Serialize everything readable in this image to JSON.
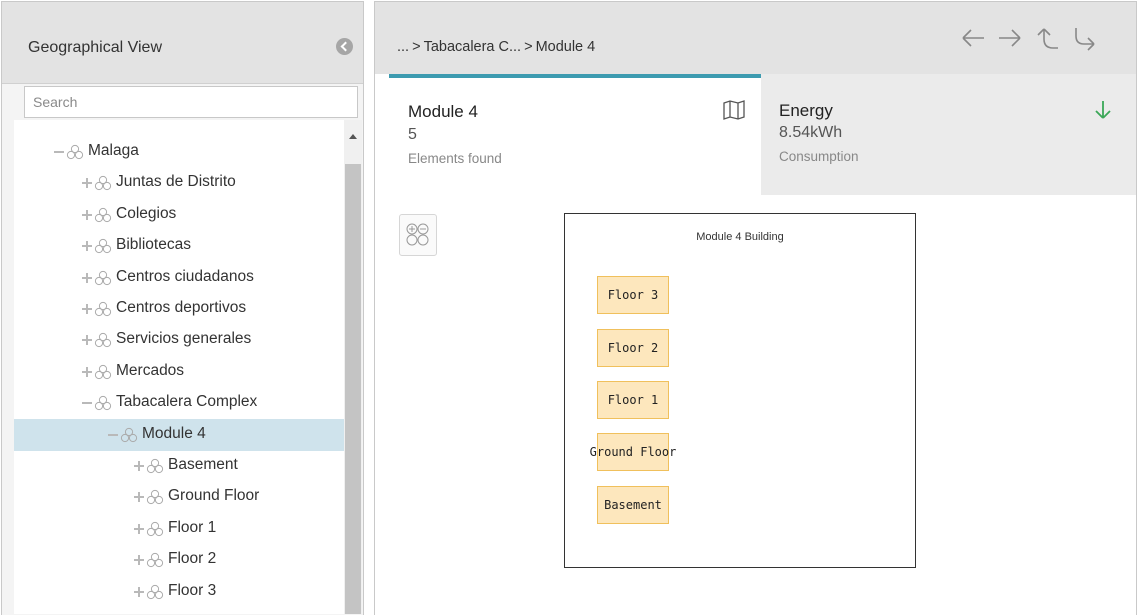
{
  "left_panel": {
    "title": "Geographical View",
    "search_placeholder": "Search",
    "partial_row": "...",
    "tree": [
      {
        "label": "Malaga",
        "level": 1,
        "toggle": "minus"
      },
      {
        "label": "Juntas de Distrito",
        "level": 2,
        "toggle": "plus"
      },
      {
        "label": "Colegios",
        "level": 2,
        "toggle": "plus"
      },
      {
        "label": "Bibliotecas",
        "level": 2,
        "toggle": "plus"
      },
      {
        "label": "Centros ciudadanos",
        "level": 2,
        "toggle": "plus"
      },
      {
        "label": "Centros deportivos",
        "level": 2,
        "toggle": "plus"
      },
      {
        "label": "Servicios generales",
        "level": 2,
        "toggle": "plus"
      },
      {
        "label": "Mercados",
        "level": 2,
        "toggle": "plus"
      },
      {
        "label": "Tabacalera Complex",
        "level": 2,
        "toggle": "minus"
      },
      {
        "label": "Module 4",
        "level": 3,
        "toggle": "minus",
        "selected": true
      },
      {
        "label": "Basement",
        "level": 4,
        "toggle": "plus"
      },
      {
        "label": "Ground Floor",
        "level": 4,
        "toggle": "plus"
      },
      {
        "label": "Floor 1",
        "level": 4,
        "toggle": "plus"
      },
      {
        "label": "Floor 2",
        "level": 4,
        "toggle": "plus"
      },
      {
        "label": "Floor 3",
        "level": 4,
        "toggle": "plus"
      }
    ]
  },
  "breadcrumb": {
    "ellipsis": "...",
    "separator": ">",
    "parent": "Tabacalera C...",
    "current": "Module 4"
  },
  "nav_icons": [
    "arrow-left-icon",
    "arrow-right-icon",
    "arrow-up-icon",
    "turn-right-icon"
  ],
  "summary_card": {
    "title": "Module 4",
    "value": "5",
    "subtitle": "Elements found",
    "icon": "map-icon"
  },
  "energy_card": {
    "title": "Energy",
    "value": "8.54kWh",
    "subtitle": "Consumption",
    "icon": "arrow-down-icon",
    "icon_color": "#3aa757"
  },
  "diagram": {
    "title": "Module 4 Building",
    "floors": [
      "Floor 3",
      "Floor 2",
      "Floor 1",
      "Ground Floor",
      "Basement"
    ]
  },
  "colors": {
    "accent": "#3d9bb0",
    "selected_row": "#cfe3ec",
    "floor_fill": "#fde7bd",
    "floor_border": "#f0c05c"
  }
}
